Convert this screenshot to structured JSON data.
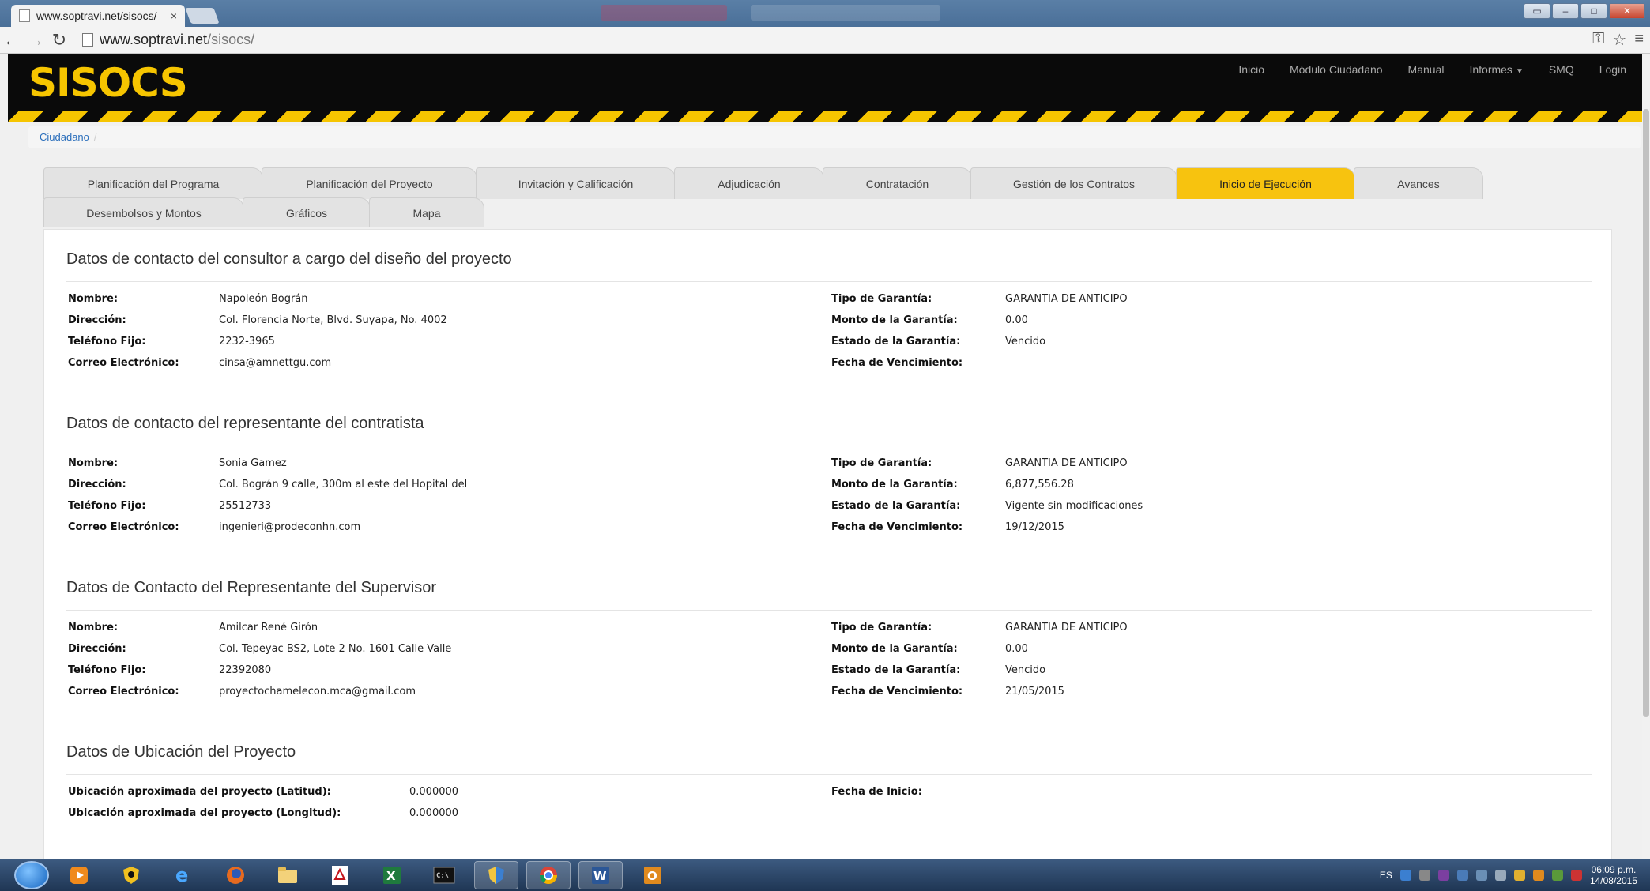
{
  "browser": {
    "tab_title": "www.soptravi.net/sisocs/",
    "tab_close": "×",
    "url_host": "www.soptravi.net",
    "url_path": "/sisocs/"
  },
  "site": {
    "logo": "SISOCS",
    "nav": [
      "Inicio",
      "Módulo Ciudadano",
      "Manual",
      "Informes",
      "SMQ",
      "Login"
    ]
  },
  "breadcrumb": {
    "item": "Ciudadano",
    "sep": "/"
  },
  "tabs_row1": [
    {
      "label": "Planificación del Programa"
    },
    {
      "label": "Planificación del Proyecto"
    },
    {
      "label": "Invitación y Calificación"
    },
    {
      "label": "Adjudicación"
    },
    {
      "label": "Contratación"
    },
    {
      "label": "Gestión de los Contratos"
    },
    {
      "label": "Inicio de Ejecución",
      "active": true
    },
    {
      "label": "Avances"
    }
  ],
  "tabs_row2": [
    {
      "label": "Desembolsos y Montos"
    },
    {
      "label": "Gráficos"
    },
    {
      "label": "Mapa"
    }
  ],
  "labels": {
    "nombre": "Nombre:",
    "direccion": "Dirección:",
    "telefono": "Teléfono Fijo:",
    "correo": "Correo Electrónico:",
    "tipo": "Tipo de Garantía:",
    "monto": "Monto de la Garantía:",
    "estado": "Estado de la Garantía:",
    "fecha_venc": "Fecha de Vencimiento:",
    "lat": "Ubicación aproximada del proyecto (Latitud):",
    "lon": "Ubicación aproximada del proyecto (Longitud):",
    "fecha_inicio": "Fecha de Inicio:"
  },
  "consultor": {
    "title": "Datos de contacto del consultor a cargo del diseño del proyecto",
    "nombre": "Napoleón Bográn",
    "direccion": "Col. Florencia Norte, Blvd. Suyapa, No. 4002",
    "telefono": "2232-3965",
    "correo": "cinsa@amnettgu.com",
    "tipo": "GARANTIA DE ANTICIPO",
    "monto": "0.00",
    "estado": "Vencido",
    "fecha_venc": ""
  },
  "contratista": {
    "title": "Datos de contacto del representante del contratista",
    "nombre": "Sonia Gamez",
    "direccion": "Col. Bográn 9 calle, 300m al este del Hopital del",
    "telefono": "25512733",
    "correo": "ingenieri@prodeconhn.com",
    "tipo": "GARANTIA DE ANTICIPO",
    "monto": "6,877,556.28",
    "estado": "Vigente sin modificaciones",
    "fecha_venc": "19/12/2015"
  },
  "supervisor": {
    "title": "Datos de Contacto del Representante del Supervisor",
    "nombre": "Amilcar René Girón",
    "direccion": "Col. Tepeyac BS2, Lote 2 No. 1601 Calle Valle",
    "telefono": "22392080",
    "correo": "proyectochamelecon.mca@gmail.com",
    "tipo": "GARANTIA DE ANTICIPO",
    "monto": "0.00",
    "estado": "Vencido",
    "fecha_venc": "21/05/2015"
  },
  "ubicacion": {
    "title": "Datos de Ubicación del Proyecto",
    "lat": "0.000000",
    "lon": "0.000000",
    "fecha_inicio": ""
  },
  "taskbar": {
    "lang": "ES",
    "time": "06:09 p.m.",
    "date": "14/08/2015"
  },
  "colors": {
    "accent": "#f7c30f",
    "header_bg": "#0a0a0a",
    "link": "#2a6ebb"
  }
}
